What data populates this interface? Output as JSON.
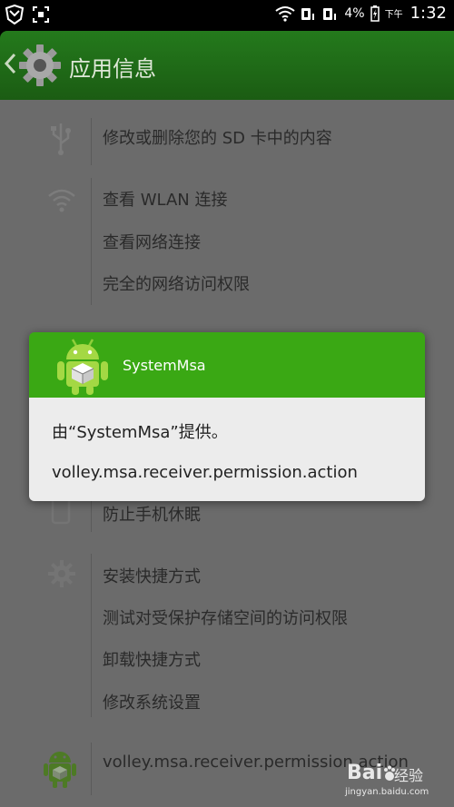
{
  "status_bar": {
    "battery": "4%",
    "ampm": "下午",
    "time": "1:32"
  },
  "action_bar": {
    "title": "应用信息"
  },
  "permissions": [
    {
      "label": "修改或删除您的 SD 卡中的内容",
      "group_icon": "usb-icon"
    },
    {
      "label": "查看 WLAN 连接",
      "group_icon": "wifi-icon"
    },
    {
      "label": "查看网络连接"
    },
    {
      "label": "完全的网络访问权限"
    },
    {
      "label": "防止手机休眠",
      "group_icon": "phone-icon"
    },
    {
      "label": "安装快捷方式",
      "group_icon": "settings-icon"
    },
    {
      "label": "测试对受保护存储空间的访问权限"
    },
    {
      "label": "卸载快捷方式"
    },
    {
      "label": "修改系统设置"
    },
    {
      "label": "volley.msa.receiver.permission.action",
      "group_icon": "android-app-icon"
    }
  ],
  "dialog": {
    "title": "SystemMsa",
    "provided_by": "由“SystemMsa”提供。",
    "permission_name": "volley.msa.receiver.permission.action"
  },
  "watermark": {
    "brand": "Bai",
    "brand_suffix": "经验",
    "url": "jingyan.baidu.com"
  },
  "colors": {
    "action_bar": "#1f6a16",
    "dialog_header": "#3aa814",
    "dim_background": "#6b6b6b"
  }
}
